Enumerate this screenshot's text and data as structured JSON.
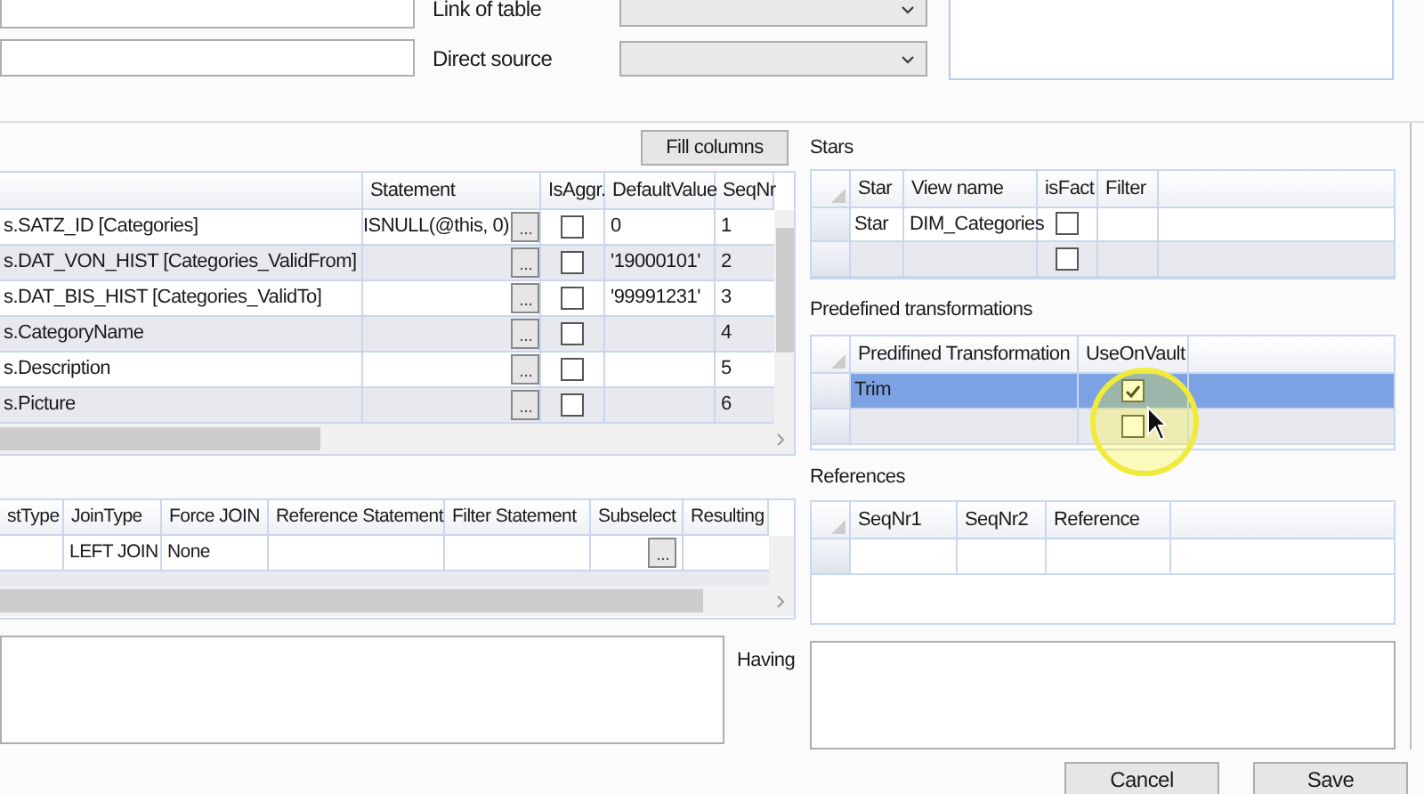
{
  "top_form": {
    "fields": [
      {
        "label": "Link of table"
      },
      {
        "label": "Direct source"
      }
    ]
  },
  "columns_panel": {
    "fill_button": "Fill columns",
    "columns": [
      "Statement",
      "IsAggr.",
      "DefaultValue",
      "SeqNr"
    ],
    "rows": [
      {
        "column_1": "s.SATZ_ID [Categories]",
        "statement": "ISNULL(@this, 0)",
        "is_aggr": false,
        "default_value": "0",
        "seq_nr": "1"
      },
      {
        "column_1": "s.DAT_VON_HIST [Categories_ValidFrom]",
        "is_aggr": false,
        "default_value": "'19000101'",
        "seq_nr": "2"
      },
      {
        "column_1": "s.DAT_BIS_HIST [Categories_ValidTo]",
        "is_aggr": false,
        "default_value": "'99991231'",
        "seq_nr": "3"
      },
      {
        "column_1": "s.CategoryName",
        "is_aggr": false,
        "seq_nr": "4"
      },
      {
        "column_1": "s.Description",
        "is_aggr": false,
        "seq_nr": "5"
      },
      {
        "column_1": "s.Picture",
        "is_aggr": false,
        "seq_nr": "6"
      }
    ]
  },
  "joins": {
    "columns": [
      "stType",
      "JoinType",
      "Force JOIN",
      "Reference Statement",
      "Filter Statement",
      "Subselect",
      "Resulting"
    ],
    "rows": [
      {
        "join_type": "LEFT JOIN",
        "force_join": "None"
      }
    ]
  },
  "having": {
    "label": "Having"
  },
  "stars": {
    "title": "Stars",
    "columns": [
      "Star",
      "View name",
      "isFact",
      "Filter"
    ],
    "rows": [
      {
        "star": "Star",
        "view_name": "DIM_Categories",
        "is_fact": false
      },
      {
        "is_fact": false
      }
    ]
  },
  "transformations": {
    "title": "Predefined transformations",
    "columns": [
      "Predifined Transformation",
      "UseOnVault"
    ],
    "rows": [
      {
        "name": "Trim",
        "use_on_vault": true,
        "selected": true
      },
      {
        "use_on_vault": false,
        "selected": false
      }
    ]
  },
  "references": {
    "title": "References",
    "columns": [
      "SeqNr1",
      "SeqNr2",
      "Reference"
    ]
  },
  "buttons": [
    "Cancel",
    "Save"
  ]
}
